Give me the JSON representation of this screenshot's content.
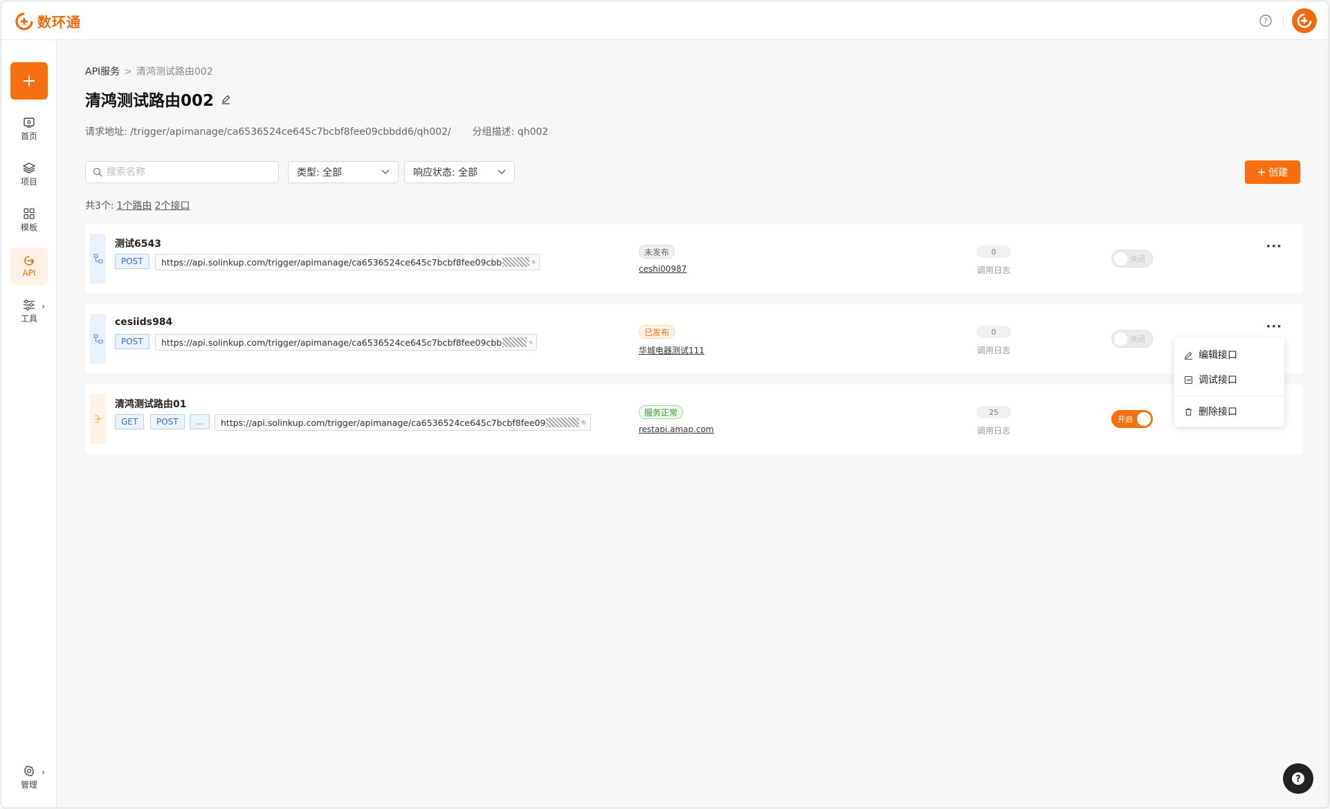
{
  "app": {
    "logo_text": "数环通",
    "brand_color": "#f86f10"
  },
  "sidebar": {
    "add_icon": "plus-icon",
    "items": [
      {
        "label": "首页",
        "icon": "home-icon"
      },
      {
        "label": "项目",
        "icon": "layers-icon"
      },
      {
        "label": "模板",
        "icon": "grid-icon"
      },
      {
        "label": "API",
        "icon": "api-icon"
      },
      {
        "label": "工具",
        "icon": "sliders-icon"
      },
      {
        "label": "管理",
        "icon": "gear-icon"
      }
    ]
  },
  "breadcrumb": {
    "root": "API服务",
    "current": "清鸿测试路由002"
  },
  "page": {
    "title": "清鸿测试路由002",
    "request_label": "请求地址:",
    "request_url": "/trigger/apimanage/ca6536524ce645c7bcbf8fee09cbbdd6/qh002/",
    "group_label": "分组描述:",
    "group_desc": "qh002"
  },
  "filters": {
    "search_placeholder": "搜索名称",
    "type_label": "类型: 全部",
    "status_label": "响应状态: 全部",
    "create_label": "创建"
  },
  "summary": {
    "total": "共3个:",
    "routes": "1个路由",
    "interfaces": "2个接口"
  },
  "items": [
    {
      "name": "测试6543",
      "methods": [
        "POST"
      ],
      "url": "https://api.solinkup.com/trigger/apimanage/ca6536524ce645c7bcbf8fee09cbb",
      "status": "未发布",
      "host": "ceshi00987",
      "count": "0",
      "count_label": "调用日志",
      "toggle": "关闭"
    },
    {
      "name": "cesiids984",
      "methods": [
        "POST"
      ],
      "url": "https://api.solinkup.com/trigger/apimanage/ca6536524ce645c7bcbf8fee09cbb",
      "status": "已发布",
      "host": "华城电器测试111",
      "count": "0",
      "count_label": "调用日志",
      "toggle": "关闭"
    },
    {
      "name": "清鸿测试路由01",
      "methods": [
        "GET",
        "POST",
        "..."
      ],
      "url": "https://api.solinkup.com/trigger/apimanage/ca6536524ce645c7bcbf8fee09",
      "status": "服务正常",
      "host": "restapi.amap.com",
      "count": "25",
      "count_label": "调用日志",
      "toggle": "开启"
    }
  ],
  "menu": {
    "edit": "编辑接口",
    "debug": "调试接口",
    "delete": "删除接口"
  }
}
